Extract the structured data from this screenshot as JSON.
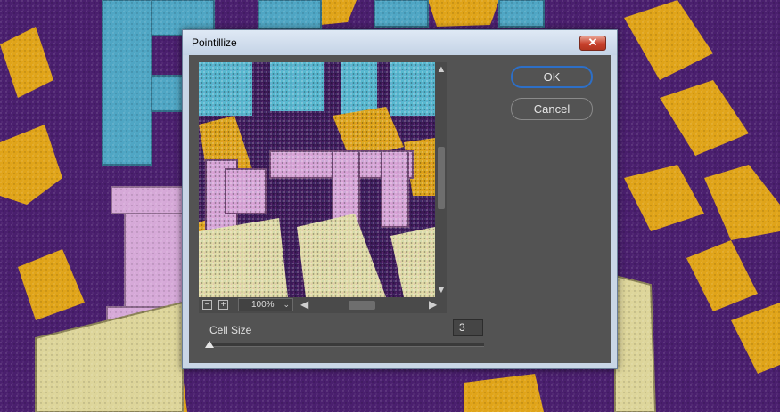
{
  "dialog": {
    "title": "Pointillize",
    "close_label": "✕"
  },
  "buttons": {
    "ok": "OK",
    "cancel": "Cancel"
  },
  "preview": {
    "zoom_out": "−",
    "zoom_in": "+",
    "zoom": "100%",
    "scroll_up": "▲",
    "scroll_down": "▼",
    "scroll_left": "◀",
    "scroll_right": "▶"
  },
  "cell_size": {
    "label": "Cell Size",
    "value": "3",
    "slider_fraction": 0.0
  },
  "colors": {
    "purple": "#4a1f6e",
    "orange": "#e0a419",
    "cyan": "#4fa6c4",
    "pink": "#d6a9d8",
    "cream": "#ddd59a",
    "ok_border": "#2d6fc7"
  },
  "icons": {
    "close": "close-icon",
    "zoom_out": "zoom-out-icon",
    "zoom_in": "zoom-in-icon",
    "chevron": "chevron-down-icon"
  }
}
